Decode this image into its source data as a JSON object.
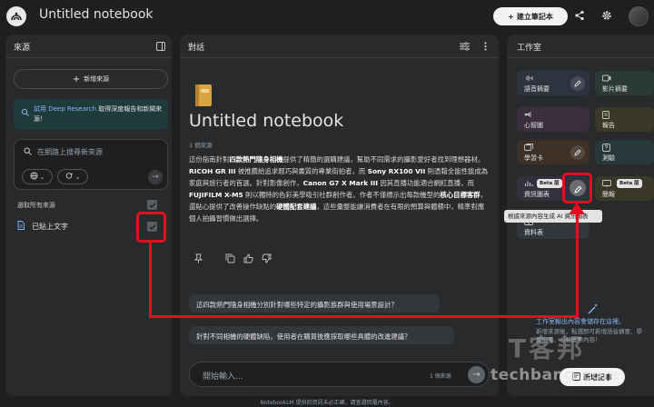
{
  "header": {
    "title": "Untitled notebook",
    "create_label": "建立筆記本"
  },
  "sources": {
    "panel_title": "來源",
    "add_source": "新增來源",
    "deep_research_link": "試用 Deep Research",
    "deep_research_text": "取得深度報告和新聞來源！",
    "search_placeholder": "在網路上搜尋新來源",
    "select_all": "選取所有來源",
    "items": [
      {
        "label": "已貼上文字",
        "checked": true
      }
    ]
  },
  "chat": {
    "panel_title": "對話",
    "notebook_title": "Untitled notebook",
    "source_count": "1 個來源",
    "summary_parts": [
      {
        "t": "這份指南針對",
        "b": false
      },
      {
        "t": "四款熱門隨身相機",
        "b": true
      },
      {
        "t": "提供了精簡的選購建議，幫助不同需求的攝影愛好者找到理想器材。",
        "b": false
      },
      {
        "t": "RICOH GR III",
        "b": true
      },
      {
        "t": " 被推薦給追求輕巧與畫質的專業街拍者，而 ",
        "b": false
      },
      {
        "t": "Sony RX100 VII",
        "b": true
      },
      {
        "t": " 則憑藉全能性能成為家庭與旅行者的首選。針對影像創作，",
        "b": false
      },
      {
        "t": "Canon G7 X Mark III",
        "b": true
      },
      {
        "t": " 因其直播功能適合網紅直播，而 ",
        "b": false
      },
      {
        "t": "FUJIFILM X-M5",
        "b": true
      },
      {
        "t": " 則以獨特的色彩美學吸引社群創作者。作者不僅標示出每款機型的",
        "b": false
      },
      {
        "t": "核心目標客群",
        "b": true
      },
      {
        "t": "，還貼心提供了改善操作缺點的",
        "b": false
      },
      {
        "t": "硬體配套建議",
        "b": true
      },
      {
        "t": "，這些彙整能讓消費者在有限的預算與體積中，精準對應個人拍攝習慣做出選擇。",
        "b": false
      }
    ],
    "suggestions": [
      "這四款熱門隨身相機分別針對哪些特定的攝影族群與使用場景設計？",
      "針對不同相機的硬體缺陷，使用者在購買後應採取哪些具體的改進建議？"
    ],
    "input_placeholder": "開始輸入...",
    "input_source_count": "1 個來源"
  },
  "studio": {
    "panel_title": "工作室",
    "tiles": [
      {
        "label": "語音摘要",
        "icon": "audio-icon",
        "color": "#2e3340"
      },
      {
        "label": "影片摘要",
        "icon": "video-icon",
        "color": "#2b3a33"
      },
      {
        "label": "心智圖",
        "icon": "mindmap-icon",
        "color": "#3a2e3d"
      },
      {
        "label": "報告",
        "icon": "report-icon",
        "color": "#3a3826"
      },
      {
        "label": "學習卡",
        "icon": "flashcard-icon",
        "color": "#3d3026"
      },
      {
        "label": "測驗",
        "icon": "quiz-icon",
        "color": "#26383a"
      },
      {
        "label": "資訊圖表",
        "icon": "infographic-icon",
        "color": "#33313d",
        "beta": "Beta 版"
      },
      {
        "label": "簡報",
        "icon": "slides-icon",
        "color": "#3a3826",
        "beta": "Beta 版"
      },
      {
        "label": "資料表",
        "icon": "table-icon",
        "color": "#33363a"
      }
    ],
    "tooltip": "根據來源內容生成 AI 資訊圖表",
    "note_title": "工作室輸出內容會儲存在這裡。",
    "note_desc": "新增來源後，點選即可新增語音摘要、學習指南、心智圖等內容！",
    "add_note": "新增記事"
  },
  "footer": "NotebookLM 提供的資訊未必正確，請查證回覆內容。",
  "watermark": {
    "url": "techbang.com",
    "brand": "T客邦"
  },
  "accent_red": "#e01020"
}
